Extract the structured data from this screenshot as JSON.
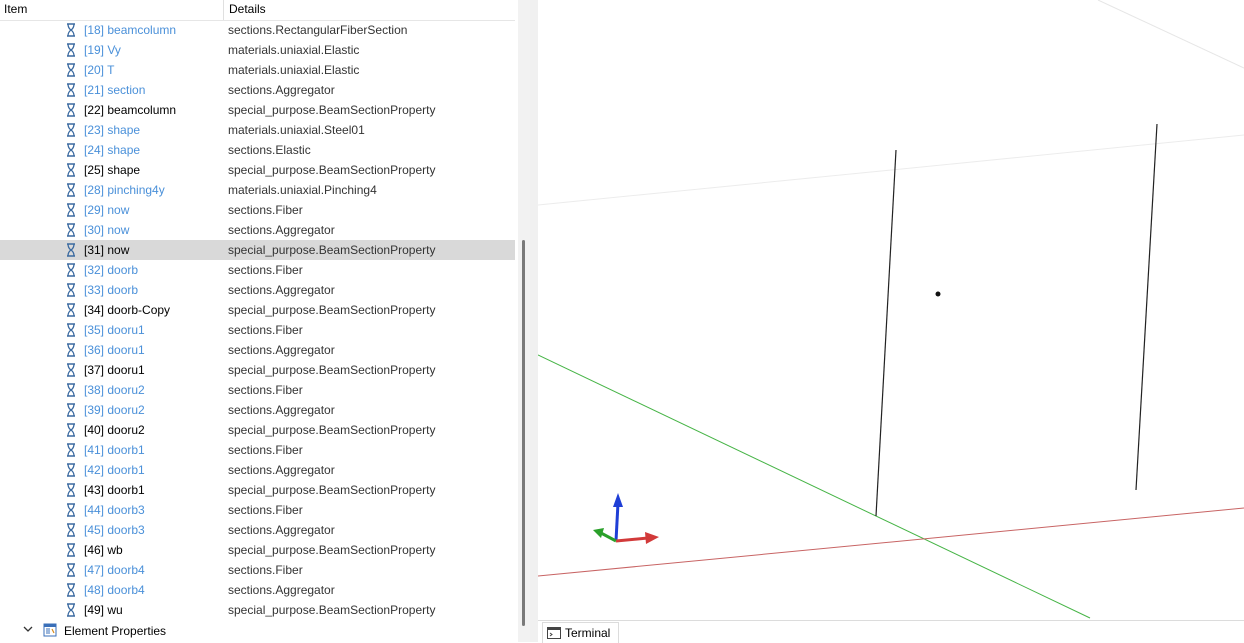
{
  "tree": {
    "header": {
      "item": "Item",
      "details": "Details"
    },
    "rows": [
      {
        "name": "[18] beamcolumn",
        "details": "sections.RectangularFiberSection",
        "style": "blue"
      },
      {
        "name": "[19] Vy",
        "details": "materials.uniaxial.Elastic",
        "style": "blue"
      },
      {
        "name": "[20] T",
        "details": "materials.uniaxial.Elastic",
        "style": "blue"
      },
      {
        "name": "[21] section",
        "details": "sections.Aggregator",
        "style": "blue"
      },
      {
        "name": "[22] beamcolumn",
        "details": "special_purpose.BeamSectionProperty",
        "style": "black"
      },
      {
        "name": "[23] shape",
        "details": "materials.uniaxial.Steel01",
        "style": "blue"
      },
      {
        "name": "[24] shape",
        "details": "sections.Elastic",
        "style": "blue"
      },
      {
        "name": "[25] shape",
        "details": "special_purpose.BeamSectionProperty",
        "style": "black"
      },
      {
        "name": "[28] pinching4y",
        "details": "materials.uniaxial.Pinching4",
        "style": "blue"
      },
      {
        "name": "[29] now",
        "details": "sections.Fiber",
        "style": "blue"
      },
      {
        "name": "[30] now",
        "details": "sections.Aggregator",
        "style": "blue"
      },
      {
        "name": "[31] now",
        "details": "special_purpose.BeamSectionProperty",
        "style": "black",
        "selected": true
      },
      {
        "name": "[32] doorb",
        "details": "sections.Fiber",
        "style": "blue"
      },
      {
        "name": "[33] doorb",
        "details": "sections.Aggregator",
        "style": "blue"
      },
      {
        "name": "[34] doorb-Copy",
        "details": "special_purpose.BeamSectionProperty",
        "style": "black"
      },
      {
        "name": "[35] dooru1",
        "details": "sections.Fiber",
        "style": "blue"
      },
      {
        "name": "[36] dooru1",
        "details": "sections.Aggregator",
        "style": "blue"
      },
      {
        "name": "[37] dooru1",
        "details": "special_purpose.BeamSectionProperty",
        "style": "black"
      },
      {
        "name": "[38] dooru2",
        "details": "sections.Fiber",
        "style": "blue"
      },
      {
        "name": "[39] dooru2",
        "details": "sections.Aggregator",
        "style": "blue"
      },
      {
        "name": "[40] dooru2",
        "details": "special_purpose.BeamSectionProperty",
        "style": "black"
      },
      {
        "name": "[41] doorb1",
        "details": "sections.Fiber",
        "style": "blue"
      },
      {
        "name": "[42] doorb1",
        "details": "sections.Aggregator",
        "style": "blue"
      },
      {
        "name": "[43] doorb1",
        "details": "special_purpose.BeamSectionProperty",
        "style": "black"
      },
      {
        "name": "[44] doorb3",
        "details": "sections.Fiber",
        "style": "blue"
      },
      {
        "name": "[45] doorb3",
        "details": "sections.Aggregator",
        "style": "blue"
      },
      {
        "name": "[46] wb",
        "details": "special_purpose.BeamSectionProperty",
        "style": "black"
      },
      {
        "name": "[47] doorb4",
        "details": "sections.Fiber",
        "style": "blue"
      },
      {
        "name": "[48] doorb4",
        "details": "sections.Aggregator",
        "style": "blue"
      },
      {
        "name": "[49] wu",
        "details": "special_purpose.BeamSectionProperty",
        "style": "black"
      }
    ],
    "element_properties": {
      "label": "Element Properties",
      "icon": "element-properties-icon"
    }
  },
  "colors": {
    "link_blue": "#4a90d9",
    "selected_row": "#d9d9d9",
    "axis_x": "#d23a3a",
    "axis_y": "#2aa02a",
    "axis_z": "#1f3fd6",
    "grid_red": "#c86464",
    "grid_green": "#46b446"
  },
  "terminal": {
    "label": "Terminal",
    "icon": "terminal-icon"
  }
}
